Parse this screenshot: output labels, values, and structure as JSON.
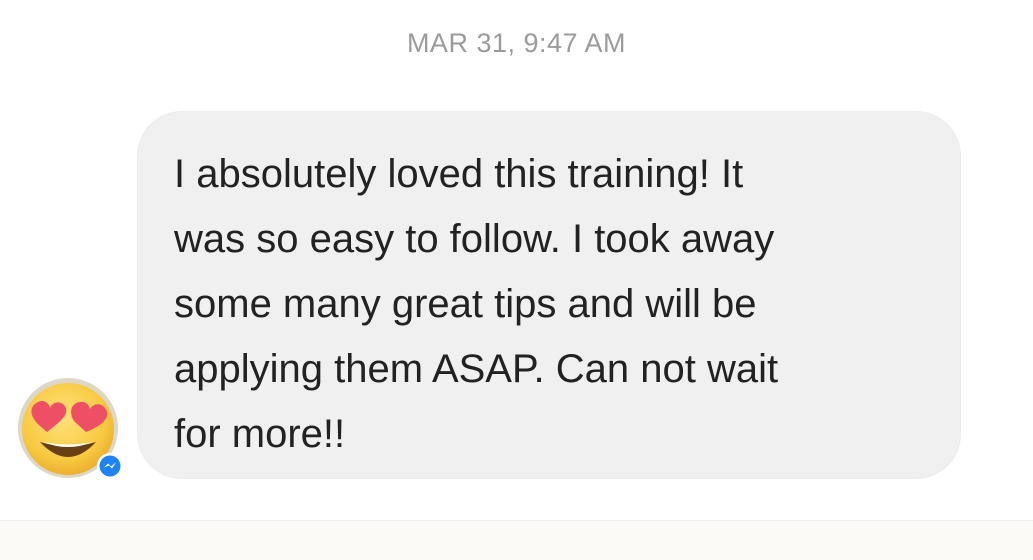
{
  "thread": {
    "timestamp": "MAR 31, 9:47 AM"
  },
  "message": {
    "lines": [
      "I absolutely loved this training! It",
      "was so easy to follow. I took away",
      "some many great tips and will be",
      "applying them ASAP. Can not wait",
      "for more!!"
    ],
    "bubble_color": "#f0f0f0",
    "text_color": "#222222"
  },
  "sender": {
    "avatar_icon": "heart-eyes-emoji-icon",
    "badge_icon": "messenger-badge-icon",
    "badge_color": "#1f83f2"
  }
}
